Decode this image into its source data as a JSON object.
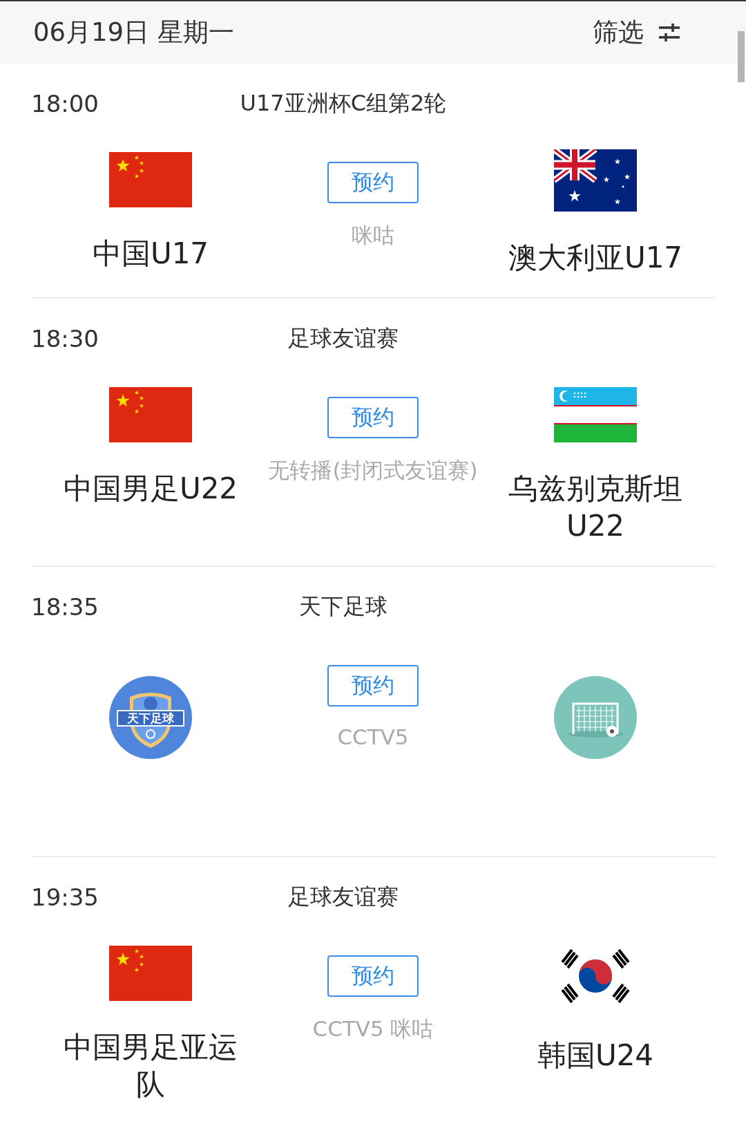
{
  "header": {
    "date": "06月19日 星期一",
    "filter_label": "筛选"
  },
  "matches": [
    {
      "time": "18:00",
      "competition": "U17亚洲杯C组第2轮",
      "home": {
        "kind": "cn",
        "name": "中国U17"
      },
      "away": {
        "kind": "au",
        "name": "澳大利亚U17"
      },
      "button": "预约",
      "broadcast": "咪咕"
    },
    {
      "time": "18:30",
      "competition": "足球友谊赛",
      "home": {
        "kind": "cn",
        "name": "中国男足U22"
      },
      "away": {
        "kind": "uz",
        "name": "乌兹别克斯坦U22"
      },
      "button": "预约",
      "broadcast": "无转播(封闭式友谊赛)"
    },
    {
      "time": "18:35",
      "competition": "天下足球",
      "home": {
        "kind": "shield",
        "logo_text": "天下足球"
      },
      "away": {
        "kind": "goal"
      },
      "button": "预约",
      "broadcast": "CCTV5"
    },
    {
      "time": "19:35",
      "competition": "足球友谊赛",
      "home": {
        "kind": "cn",
        "name": "中国男足亚运队"
      },
      "away": {
        "kind": "kr",
        "name": "韩国U24"
      },
      "button": "预约",
      "broadcast": "CCTV5 咪咕"
    }
  ]
}
